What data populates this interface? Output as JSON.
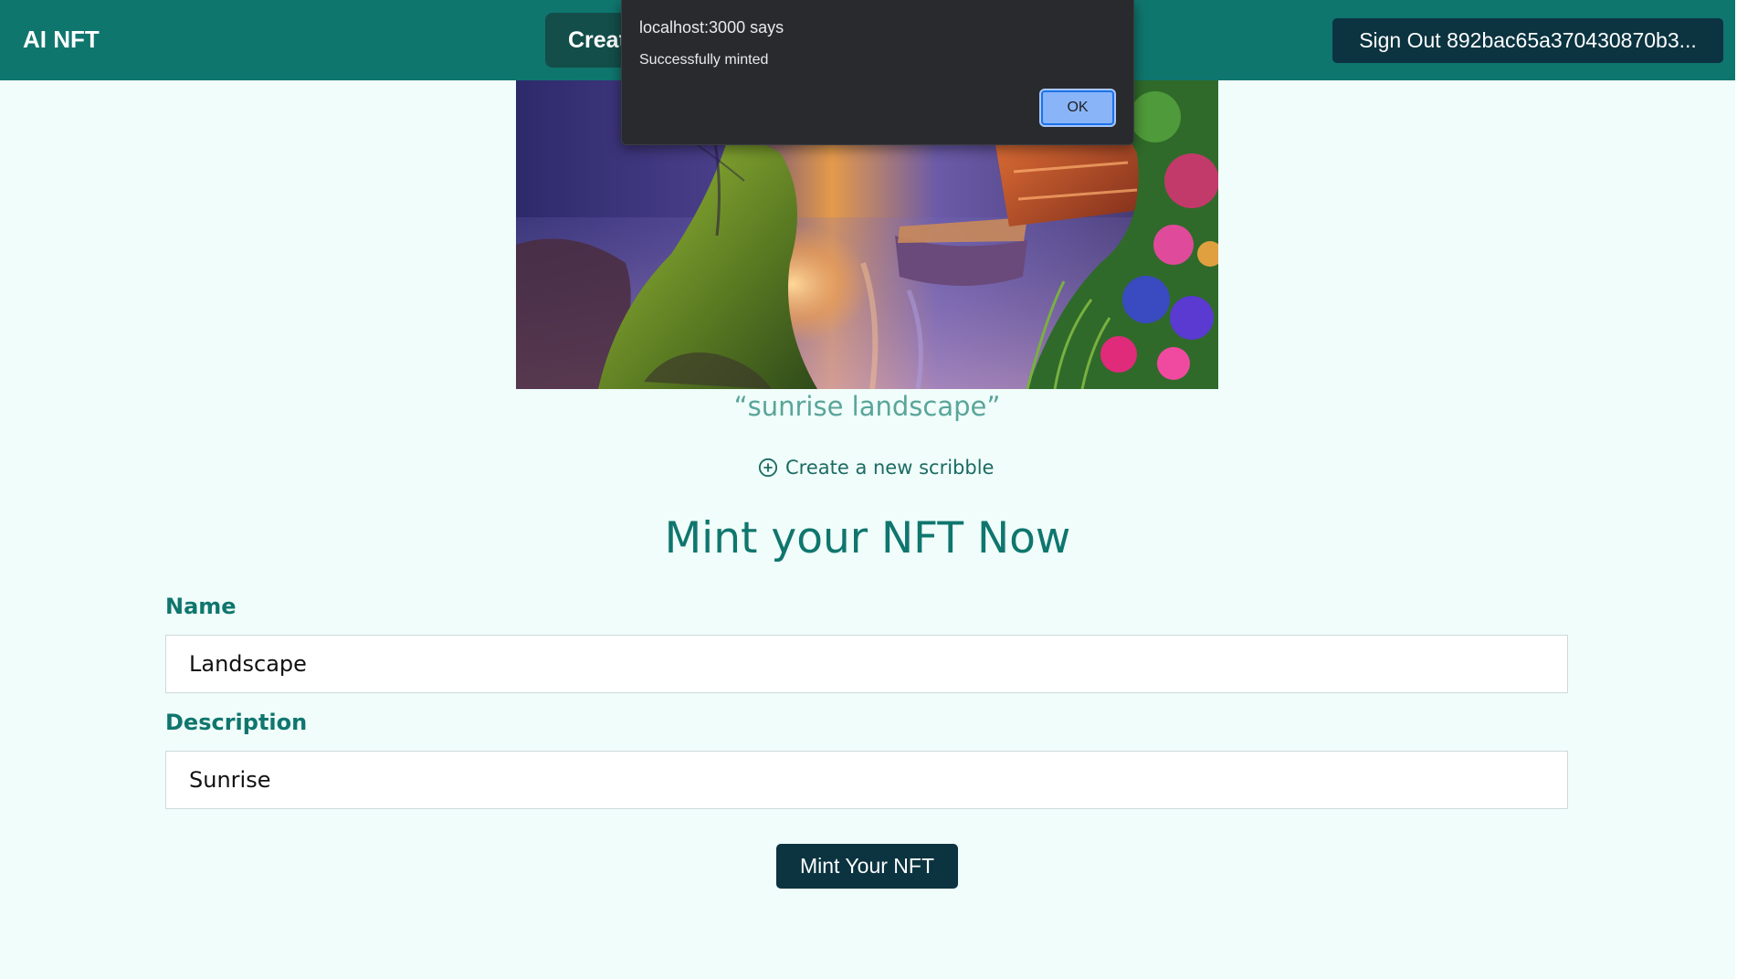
{
  "header": {
    "logo": "AI NFT",
    "create_button": "Create",
    "sign_out": "Sign Out 892bac65a370430870b3..."
  },
  "artwork": {
    "caption": "“sunrise landscape”",
    "new_scribble": "Create a new scribble"
  },
  "form": {
    "title": "Mint your NFT Now",
    "name_label": "Name",
    "name_value": "Landscape",
    "description_label": "Description",
    "description_value": "Sunrise",
    "submit_label": "Mint Your NFT"
  },
  "alert": {
    "title": "localhost:3000 says",
    "message": "Successfully minted",
    "ok_label": "OK"
  },
  "colors": {
    "header_bg": "#0f766e",
    "page_bg": "#f0fdfa",
    "accent": "#0f766e",
    "button_dark": "#0b3340",
    "dialog_bg": "#292a2d",
    "dialog_ok": "#8ab4f8"
  },
  "icons": {
    "scribble": "plus-circle-icon"
  }
}
